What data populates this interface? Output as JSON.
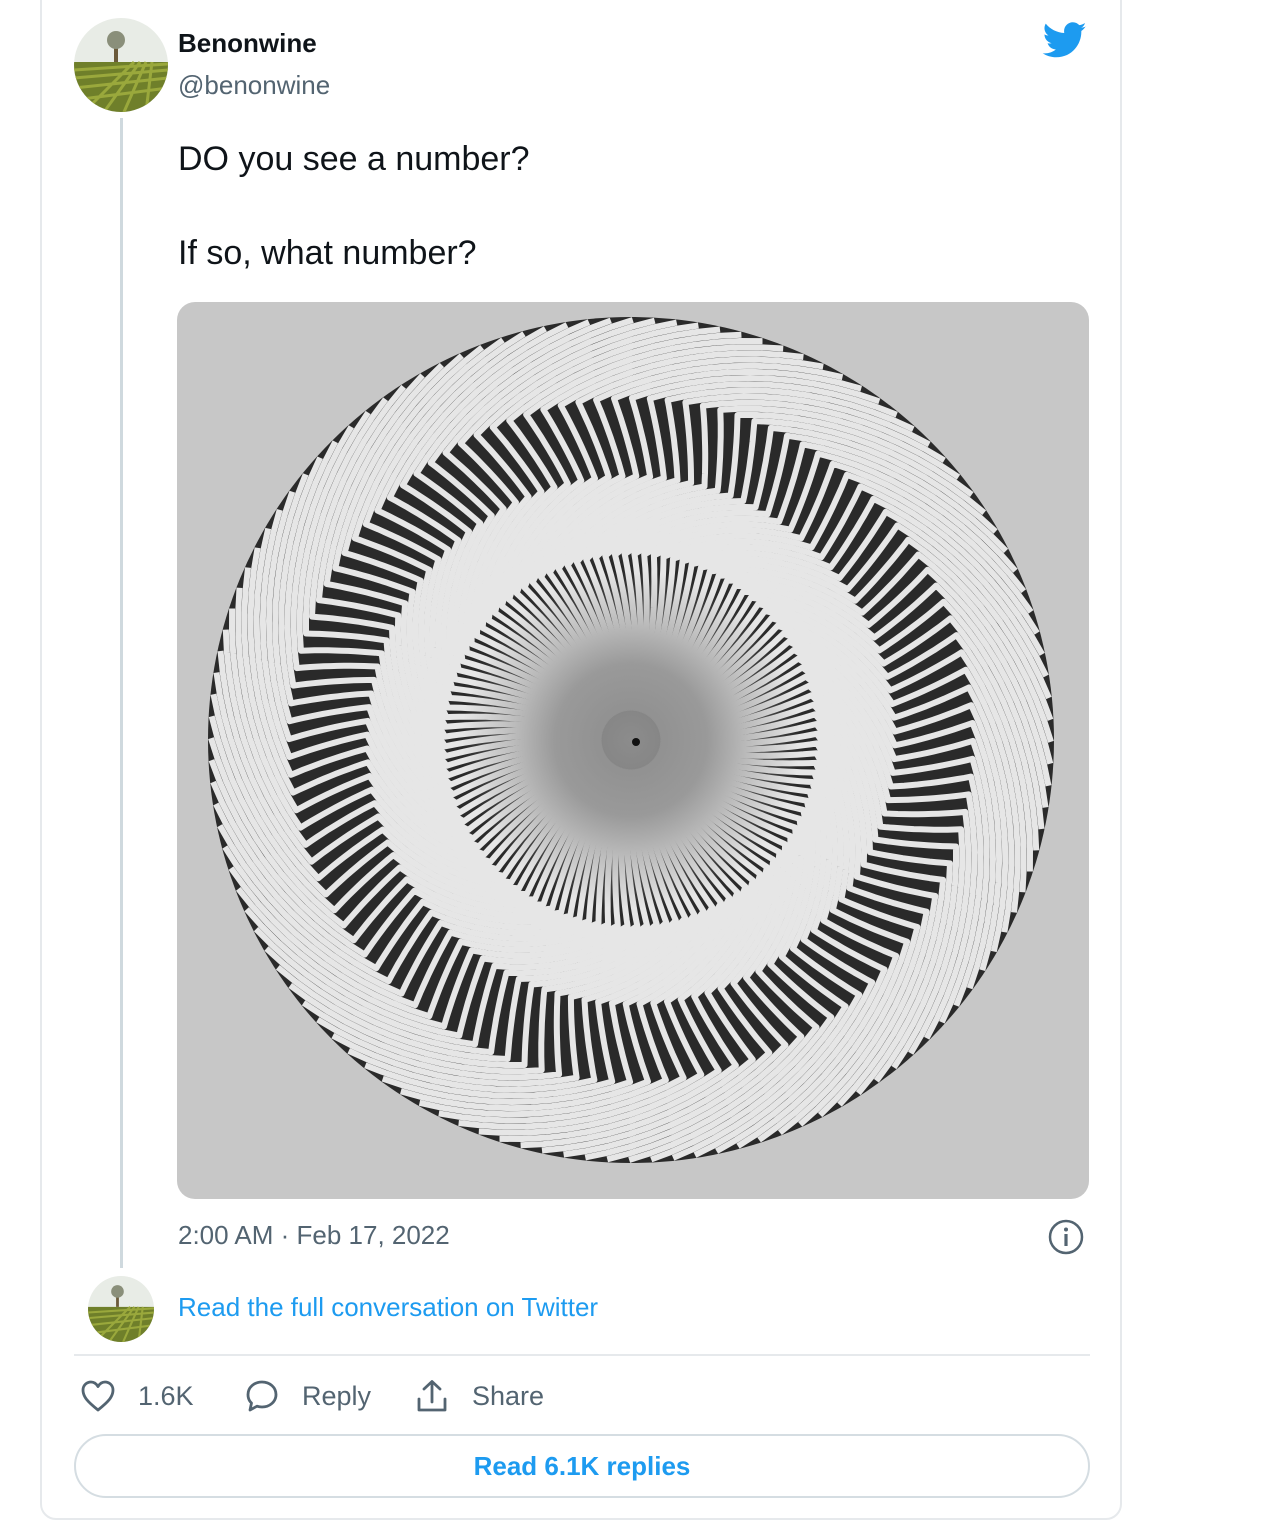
{
  "author": {
    "display_name": "Benonwine",
    "handle": "@benonwine",
    "avatar_icon": "vineyard-avatar"
  },
  "tweet": {
    "lines": [
      "DO you see a number?",
      "If so, what number?"
    ],
    "timestamp": "2:00 AM · Feb 17, 2022",
    "media_icon": "spiral-optical-illusion-image"
  },
  "conversation_link": "Read the full conversation on Twitter",
  "actions": {
    "likes_count": "1.6K",
    "reply_label": "Reply",
    "share_label": "Share"
  },
  "read_replies_label": "Read 6.1K replies",
  "colors": {
    "accent": "#1d9bf0",
    "text_primary": "#0f1419",
    "text_secondary": "#536471",
    "media_bg": "#c7c7c7"
  },
  "icons": [
    "twitter-bird-icon",
    "info-icon",
    "heart-icon",
    "reply-icon",
    "share-icon"
  ]
}
